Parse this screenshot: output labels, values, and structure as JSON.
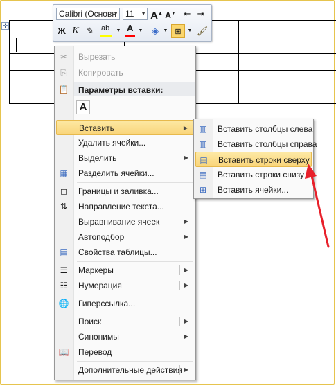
{
  "mini_toolbar": {
    "font_name": "Calibri (Основн",
    "font_size": "11",
    "grow_font": "A",
    "shrink_font": "A",
    "bold": "Ж",
    "italic": "К",
    "highlight": "ab",
    "font_color": "A"
  },
  "context_menu": {
    "items": [
      {
        "label": "Вырезать",
        "icon": "scissors-icon",
        "disabled": true
      },
      {
        "label": "Копировать",
        "icon": "copy-icon",
        "disabled": true
      },
      {
        "label": "Параметры вставки:",
        "icon": "paste-icon"
      },
      {
        "label": "Вставить",
        "arrow": true
      },
      {
        "label": "Удалить ячейки..."
      },
      {
        "label": "Выделить",
        "arrow": true
      },
      {
        "label": "Разделить ячейки...",
        "icon": "split-cells-icon"
      },
      {
        "label": "Границы и заливка...",
        "icon": "borders-icon"
      },
      {
        "label": "Направление текста...",
        "icon": "text-direction-icon"
      },
      {
        "label": "Выравнивание ячеек",
        "arrow": true
      },
      {
        "label": "Автоподбор",
        "arrow": true
      },
      {
        "label": "Свойства таблицы...",
        "icon": "table-properties-icon"
      },
      {
        "label": "Маркеры",
        "icon": "bullets-icon",
        "arrow": true
      },
      {
        "label": "Нумерация",
        "icon": "numbering-icon",
        "arrow": true
      },
      {
        "label": "Гиперссылка...",
        "icon": "hyperlink-icon"
      },
      {
        "label": "Поиск",
        "arrow": true
      },
      {
        "label": "Синонимы",
        "arrow": true
      },
      {
        "label": "Перевод",
        "icon": "translate-icon"
      },
      {
        "label": "Дополнительные действия",
        "arrow": true
      }
    ],
    "paste_option_glyph": "A"
  },
  "insert_submenu": {
    "items": [
      {
        "label": "Вставить столбцы слева",
        "icon": "insert-columns-left-icon"
      },
      {
        "label": "Вставить столбцы справа",
        "icon": "insert-columns-right-icon"
      },
      {
        "label": "Вставить строки сверху",
        "icon": "insert-rows-above-icon",
        "highlighted": true
      },
      {
        "label": "Вставить строки снизу",
        "icon": "insert-rows-below-icon"
      },
      {
        "label": "Вставить ячейки...",
        "icon": "insert-cells-icon"
      }
    ]
  },
  "colors": {
    "highlight_fill": "#f9d57a",
    "annotation_arrow": "#e8202a",
    "highlight_bar": "#ffff00",
    "font_color_bar": "#ff0000"
  }
}
